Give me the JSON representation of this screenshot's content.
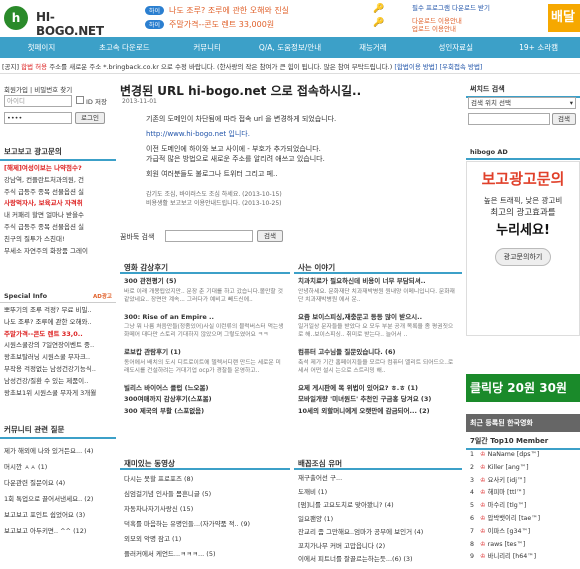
{
  "header": {
    "logo_text": "HI-BOGO.NET",
    "logo_symbol": "h",
    "promos": [
      {
        "tag": "하이",
        "text": "나도 조루? 조루에 관한 오해와 진실"
      },
      {
        "tag": "하이",
        "text": "주말가격--콘도 렌트 33,000원"
      }
    ],
    "right_links": [
      "필수 프로그램 다운로드 받기",
      "다운로드 이용안내",
      "업로드 이용안내"
    ],
    "ad_text": "배달"
  },
  "nav": [
    "첫페이지",
    "초고속 다운로드",
    "커뮤니티",
    "Q/A, 도움정보/안내",
    "재능거래",
    "성인자료실",
    "19+ 소라캠"
  ],
  "notice": {
    "label": "[공지]",
    "red": "합법 허용",
    "text": "주소를 새로운 주소 *.bringback.co.kr 으로 수정 바랍니다. (한사랑의 작은 참여가 큰 힘이 됩니다. 많은 참여 부탁드립니다.)",
    "links": [
      "[합법이용 방법]",
      "[우회접속 방법]"
    ]
  },
  "login": {
    "title": "회원가입 | 비밀번호 찾기",
    "id_placeholder": "아이디",
    "pw_placeholder": "••••",
    "save_label": "ID 저장",
    "login_button": "로그인"
  },
  "left_ad": {
    "title": "보고보고 광고문의",
    "items": [
      "[해제]여성이보는 나약점수?",
      "강남역, 컨플란트처과의원, 건",
      "주식 급등주 종목 선물옵션 실",
      "사랑먹자사, 보육교사 자격취",
      "내 커패리 할면 얼마나 받을수",
      "주식 급등주 종목 선물옵션 실",
      "친구의 질투가 스친대!",
      "무세소 자연주의 화장품 그레이"
    ],
    "red_indices": [
      0,
      3
    ]
  },
  "special": {
    "title": "Special Info",
    "badge": "AD광고",
    "items": [
      "뽀뚜기의 조루 걱정? 무료 비밀..",
      "나도 조루? 조루에 관한 오해와..",
      "주말가격--콘도 렌트 33,0..",
      "시원스쿨강의 7일연장이벤트 중..",
      "왕초보탈러닝 시원스쿨 무자크..",
      "부작용 걱정없는 남성건강기능식..",
      "남성건강/질환 수 있는 제품이..",
      "왕초보1위 시원스쿨 무자게 3개월"
    ],
    "red_indices": [
      2
    ]
  },
  "community": {
    "title": "커뮤니티 관련 질문",
    "items": [
      "제가 해외에 나와 있거든요... (4)",
      "머시깐 ㅅㅅ (1)",
      "다운관련 질문이요 (4)",
      "1회 톡업으로 끌어서낸세요.. (2)",
      "보고보고 포인트 쉽었어요 (3)",
      "보고보고 아두키면.. ^^ (12)"
    ]
  },
  "article": {
    "title": "변경된 URL hi-bogo.net 으로 접속하시길..",
    "date": "2013-11-01",
    "lines": [
      "기존의 도메인이 차단됨에 따라 접속 url 을 변경하게 되었습니다.",
      "http://www.hi-bogo.net 입니다.",
      "이전 도메인에 하이와 보고 사이에 - 부호가 추가되었습니다.",
      "가급적 많은 방법으로 새로운 주소를 알리려 애쓰고 있습니다.",
      "회원 여러분들도 불로그나 트위터 그리고 페.."
    ],
    "meta1": "감기도 조심, 바이러스도 조심 하세요. (2013-10-15)",
    "meta2": "비용생활 보고보고 이용안내드립니다. (2013-10-25)"
  },
  "search": {
    "label": "꿈바둑 검색",
    "button": "검색"
  },
  "sections": {
    "movie": {
      "title": "영화 감상후기",
      "items": [
        {
          "t": "300 관전평기 (5)",
          "s": "바로 이래 개봉됩었지만.. 문장 춘 기대를 하고 갔습니다.볼만할 것 같았네요.. 장면만 계속... 그러다가 예비고 빼드신에.."
        },
        {
          "t": "300: Rise of an Empire ..",
          "s": "그냥 뭐 나름 처음만들(정좀있어)사실 이런류의 블럭버스터 먹는생화떼어 대다만 스토리 기대하지 않았으며 그렇도였어요 ㅋㅋ"
        },
        {
          "t": "로보캅 관람후기 (1)",
          "s": "동어에서 배치의 도시 디트로이트에 델렉서디랜 만드는 세로운 미래도시를 건설하려는 거대기업 ocp가 경찰들 운영하고.."
        },
        {
          "t": "빌리스 바이어스 클럽 (느오봄)",
          "s": ""
        },
        {
          "t": "300여매까지 감상후기(스포봄)",
          "s": ""
        },
        {
          "t": "300 제국의 부활 (스포없음)",
          "s": ""
        }
      ]
    },
    "life": {
      "title": "사는 이야기",
      "items": [
        {
          "t": "치과치료가 필요하신데 비용이 너무 부담되셔..",
          "s": "안녕하세요. 문화재단 치과재박병원 원내양 이메니입니다. 문화재단 치과재박병원 에서 운.."
        },
        {
          "t": "요즘 보이스피싱,재충문고 등등 많이 받으시..",
          "s": "일거일상 문자들을 받았다 요 모두 부분 공개 목록을 좀 평권짓으로 해..보이스피싱.. 취미로 받는다.. 늘어서 .."
        },
        {
          "t": "컴퓨터 고수님들 질문있습니다. (6)",
          "s": "축석 제가 기간 홈페이지들을 모르다 컴퓨터 엘리트 되어드으..로세서 어떤 설시 는으로 스트리밍 해.."
        },
        {
          "t": "요제 게시판에 목 위법이 있어요? ㅎ.ㅎ (1)",
          "s": ""
        },
        {
          "t": "모바일개량 '미녀원드' 추천인 구금홍 당겨요 (3)",
          "s": ""
        },
        {
          "t": "10세의 외할머니에게 오랫만에 감금되어... (2)",
          "s": ""
        }
      ]
    },
    "fun": {
      "title": "재미있는 동영상",
      "items": [
        "다시는 못할 프로포즈 (8)",
        "심엄걸기념 인사들 몸흔니글 (5)",
        "자동차나자기사랑신 (15)",
        "덕혹를 마음하는 유명인들...(자가약품 적.. (9)",
        "외모외 악명 잠고 (1)",
        "플러커에서 케언드...ㅋㅋㅋ... (5)"
      ]
    },
    "humor": {
      "title": "배꼽조심 유머",
      "items": [
        "재구출어선 구...",
        "도깨비 (1)",
        "[펌]니를 고요도치로 맞아봤니? (4)",
        "일요팬양 (1)",
        "잔교리 좀 그만해요..엄마가 공부에 보인거 (4)",
        "꼬치가나무 커버 고맙읍니다 (2)",
        "이에서 피트너를 잘끌르는하는듯...(6) (3)"
      ]
    }
  },
  "right": {
    "search_title": "써치드 검색",
    "search_select": "검색 위치 선택",
    "search_button": "검색",
    "ad_title": "hibogo AD",
    "ad_headline": "보고광고문의",
    "ad_sub1": "높은 트래픽, 낮은 광고비",
    "ad_sub2": "최고의 광고효과를",
    "ad_sub3": "누리세요!",
    "ad_button": "광고문의하기",
    "yellow_ad": "클릭당 20원 30원",
    "reg_title": "최근 등록된 한국영화",
    "top_title": "7일간 Top10 Member",
    "ranks": [
      {
        "n": "1",
        "name": "NaName [dps™]"
      },
      {
        "n": "2",
        "name": "Killer [ang™]"
      },
      {
        "n": "3",
        "name": "요사키 [idj™]"
      },
      {
        "n": "4",
        "name": "해피마 [ttl™]"
      },
      {
        "n": "5",
        "name": "마수리 [tlg™]"
      },
      {
        "n": "6",
        "name": "압박뱃이리 [tae™]"
      },
      {
        "n": "7",
        "name": "이파스 [g34™]"
      },
      {
        "n": "8",
        "name": "raws [tes™]"
      },
      {
        "n": "9",
        "name": "바니리리 [h64™]"
      }
    ]
  },
  "colors": {
    "accent": "#3ca0c8",
    "red": "#dd2222",
    "brand_green": "#2a8a2a",
    "orange": "#f6a800"
  }
}
